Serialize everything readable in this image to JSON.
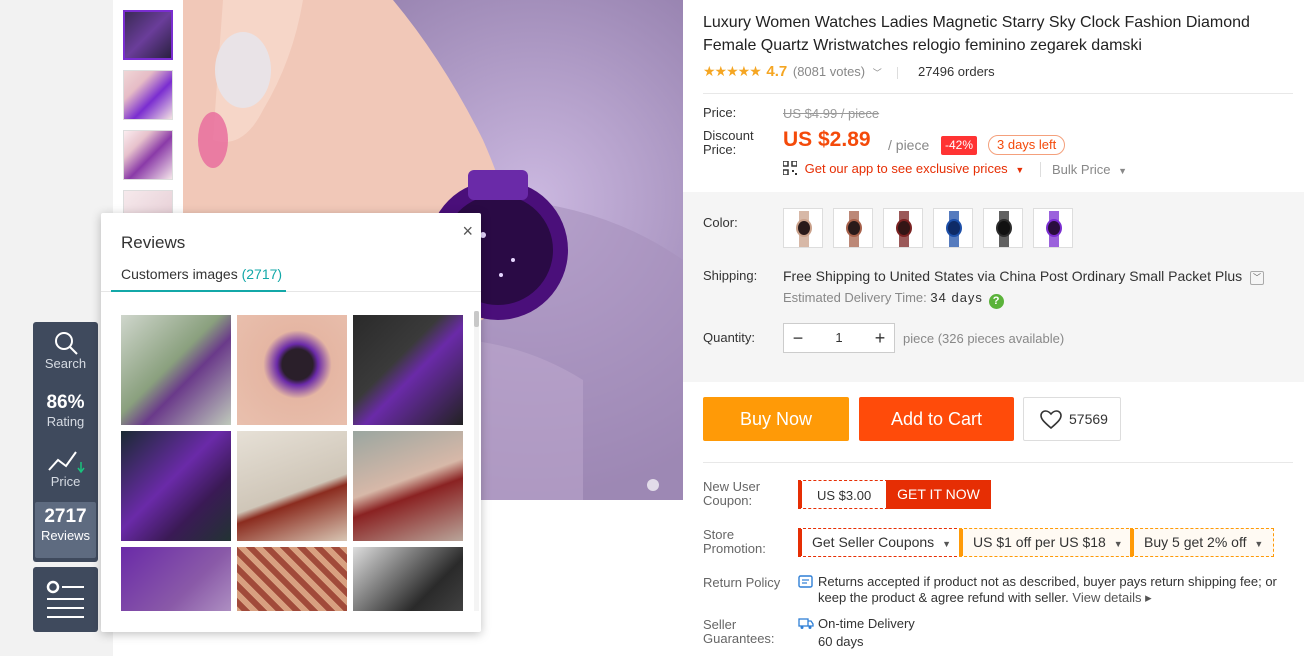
{
  "product": {
    "title": "Luxury Women Watches Ladies Magnetic Starry Sky Clock Fashion Diamond Female Quartz Wristwatches relogio feminino zegarek damski",
    "stars": "★★★★★",
    "rating_value": "4.7",
    "votes": "(8081 votes)",
    "orders": "27496 orders"
  },
  "price": {
    "price_label": "Price:",
    "old_price": "US $4.99 / piece",
    "discount_label_1": "Discount",
    "discount_label_2": "Price:",
    "new_price": "US $2.89",
    "per_piece": "/ piece",
    "discount_badge": "-42%",
    "days_left": "3 days left",
    "app_link": "Get our app to see exclusive prices",
    "bulk_price": "Bulk Price"
  },
  "options": {
    "color_label": "Color:",
    "swatches": [
      {
        "face": "#2a1a1a",
        "band": "#c9a08a"
      },
      {
        "face": "#2a1a1a",
        "band": "#a6604a"
      },
      {
        "face": "#331515",
        "band": "#7a2222"
      },
      {
        "face": "#0e2a66",
        "band": "#1d4fa8"
      },
      {
        "face": "#111111",
        "band": "#2c2c2c"
      },
      {
        "face": "#2a0d3d",
        "band": "#7a2dd0"
      }
    ],
    "shipping_label": "Shipping:",
    "shipping_text": "Free Shipping to United States via China Post Ordinary Small Packet Plus",
    "delivery_label": "Estimated Delivery Time:",
    "delivery_days": "34 days",
    "quantity_label": "Quantity:",
    "quantity_value": "1",
    "quantity_available": "piece (326 pieces available)"
  },
  "actions": {
    "buy_now": "Buy Now",
    "add_to_cart": "Add to Cart",
    "wishlist_count": "57569"
  },
  "coupons": {
    "new_user_label_1": "New User",
    "new_user_label_2": "Coupon:",
    "coupon_amount": "US $3.00",
    "get_it_now": "GET IT NOW",
    "store_promo_label_1": "Store",
    "store_promo_label_2": "Promotion:",
    "seller_coupons": "Get Seller Coupons",
    "promo_1": "US $1 off per US $18",
    "promo_2": "Buy 5 get 2% off",
    "return_label": "Return Policy",
    "return_text": "Returns accepted if product not as described, buyer pays return shipping fee; or keep the product & agree refund with seller.",
    "view_details": "View details",
    "guarantee_label_1": "Seller",
    "guarantee_label_2": "Guarantees:",
    "guarantee_1": "On-time Delivery",
    "guarantee_2": "60 days"
  },
  "sidebar": {
    "search_label": "Search",
    "rating_value": "86%",
    "rating_label": "Rating",
    "price_label": "Price",
    "reviews_count": "2717",
    "reviews_label": "Reviews"
  },
  "reviews_popup": {
    "title": "Reviews",
    "close": "×",
    "tab_label": "Customers images",
    "tab_count": "(2717)"
  },
  "colors": {
    "accent_red": "#f44a0a",
    "accent_orange": "#ff9a07",
    "teal": "#13a8a8",
    "sidebar_bg": "#3f4a5d"
  }
}
